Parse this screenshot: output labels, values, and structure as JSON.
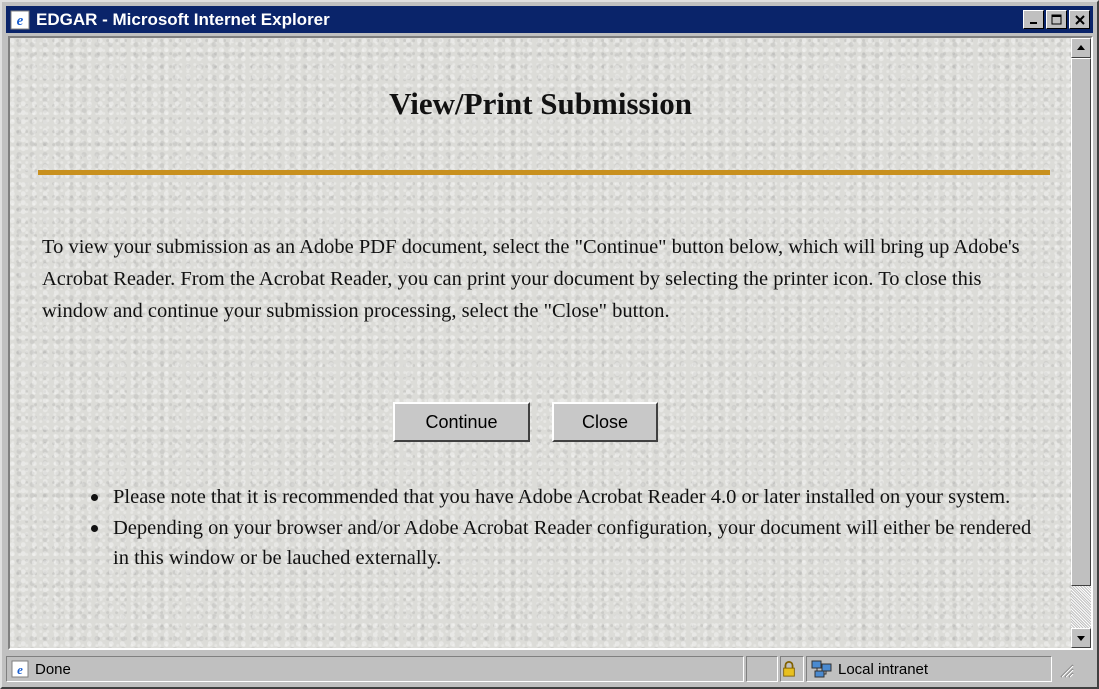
{
  "window": {
    "title": "EDGAR - Microsoft Internet Explorer",
    "icon": "ie-icon",
    "controls": [
      "minimize-icon",
      "maximize-icon",
      "close-icon"
    ]
  },
  "page": {
    "title": "View/Print Submission",
    "intro": "To view your submission as an Adobe PDF document, select the \"Continue\" button below, which will bring up Adobe's Acrobat Reader. From the Acrobat Reader, you can print your document by selecting the printer icon. To close this window and continue your submission processing, select the \"Close\" button.",
    "buttons": {
      "continue_label": "Continue",
      "close_label": "Close"
    },
    "notes": [
      "Please note that it is recommended that you have Adobe Acrobat Reader 4.0 or later installed on your system.",
      "Depending on your browser and/or Adobe Acrobat Reader configuration, your document will either be rendered in this window or be lauched externally."
    ],
    "rule_color": "#c8901e"
  },
  "status": {
    "text": "Done",
    "zone": "Local intranet"
  },
  "colors": {
    "titlebar": "#0a246a",
    "chrome": "#c0c0c0"
  }
}
